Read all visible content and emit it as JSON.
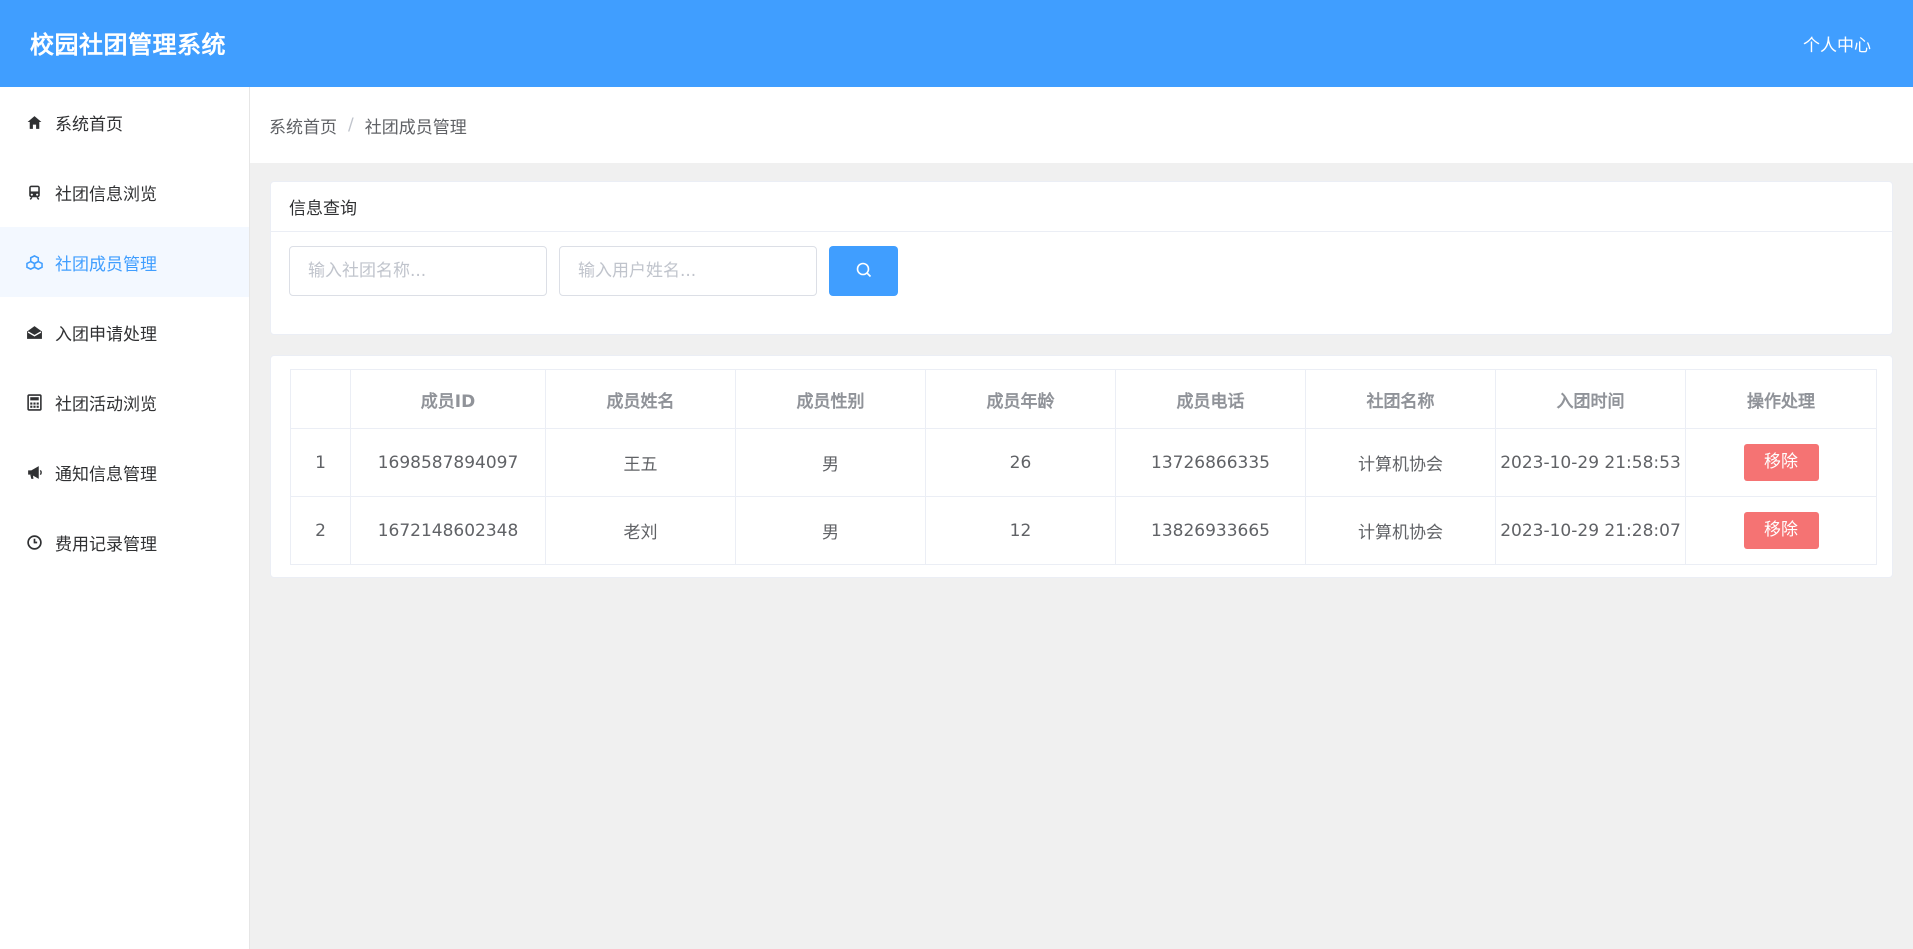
{
  "header": {
    "title": "校园社团管理系统",
    "user_center": "个人中心"
  },
  "sidebar": {
    "items": [
      {
        "label": "系统首页",
        "icon": "home-icon"
      },
      {
        "label": "社团信息浏览",
        "icon": "train-icon"
      },
      {
        "label": "社团成员管理",
        "icon": "cubes-icon",
        "active": true
      },
      {
        "label": "入团申请处理",
        "icon": "envelope-open-icon"
      },
      {
        "label": "社团活动浏览",
        "icon": "calculator-icon"
      },
      {
        "label": "通知信息管理",
        "icon": "bullhorn-icon"
      },
      {
        "label": "费用记录管理",
        "icon": "clock-icon"
      }
    ]
  },
  "breadcrumb": {
    "home": "系统首页",
    "separator": "/",
    "current": "社团成员管理"
  },
  "search": {
    "title": "信息查询",
    "club_placeholder": "输入社团名称...",
    "user_placeholder": "输入用户姓名..."
  },
  "table": {
    "headers": [
      "",
      "成员ID",
      "成员姓名",
      "成员性别",
      "成员年龄",
      "成员电话",
      "社团名称",
      "入团时间",
      "操作处理"
    ],
    "rows": [
      {
        "index": "1",
        "id": "1698587894097",
        "name": "王五",
        "gender": "男",
        "age": "26",
        "phone": "13726866335",
        "club": "计算机协会",
        "joined": "2023-10-29 21:58:53",
        "action": "移除"
      },
      {
        "index": "2",
        "id": "1672148602348",
        "name": "老刘",
        "gender": "男",
        "age": "12",
        "phone": "13826933665",
        "club": "计算机协会",
        "joined": "2023-10-29 21:28:07",
        "action": "移除"
      }
    ]
  },
  "colors": {
    "primary": "#409eff",
    "danger": "#f56c6c",
    "background": "#f0f0f0"
  }
}
